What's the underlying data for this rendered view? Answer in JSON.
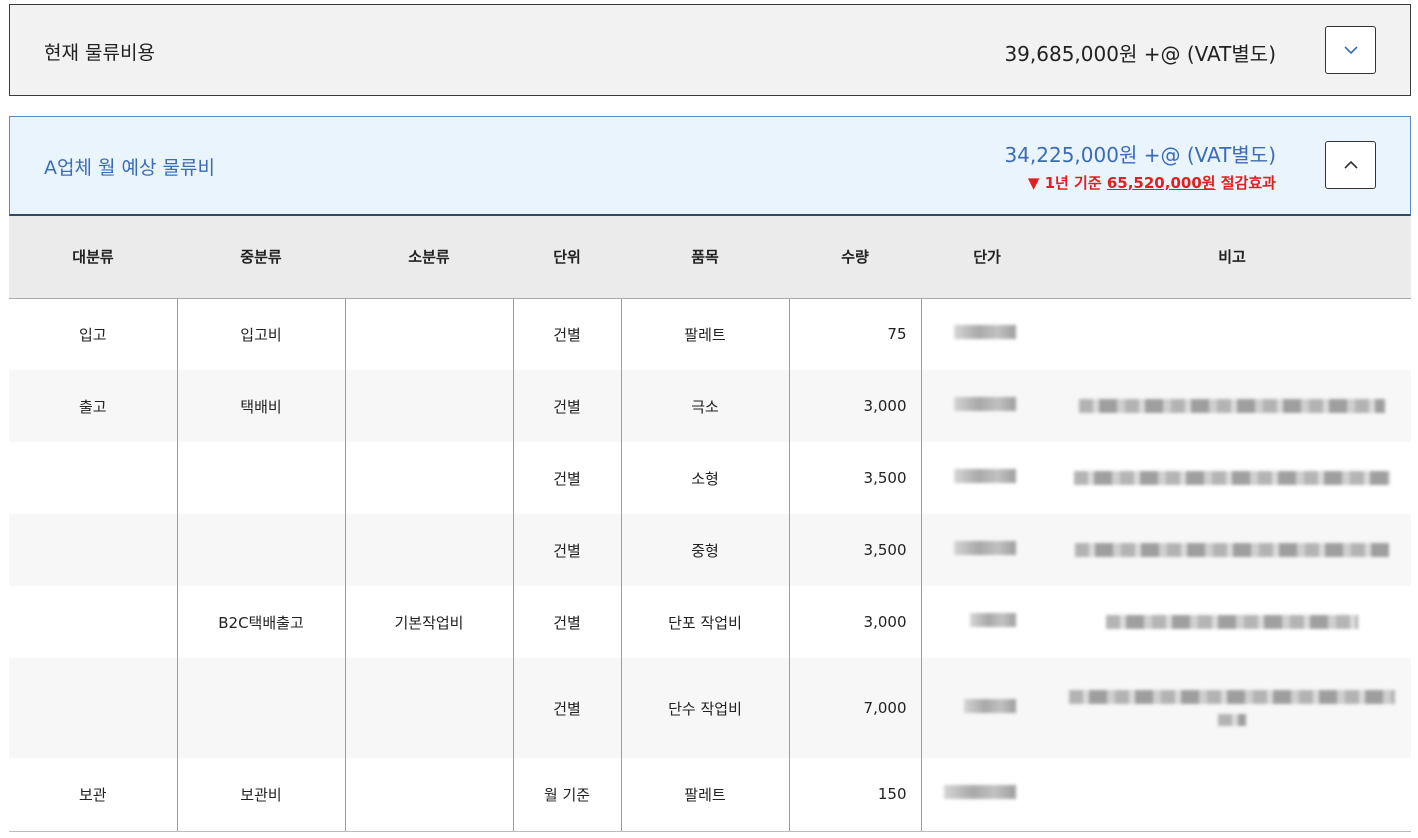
{
  "current_cost": {
    "title": "현재 물류비용",
    "amount": "39,685,000원 +@ (VAT별도)",
    "toggle_icon": "chevron-down-icon"
  },
  "vendor_estimate": {
    "title": "A업체 월 예상 물류비",
    "amount": "34,225,000원 +@ (VAT별도)",
    "savings_prefix": "▼ 1년 기준 ",
    "savings_amount": "65,520,000원",
    "savings_suffix": " 절감효과",
    "toggle_icon": "chevron-up-icon",
    "accent_color": "#3b6cb4",
    "savings_color": "#e02020"
  },
  "table": {
    "headers": [
      "대분류",
      "중분류",
      "소분류",
      "단위",
      "품목",
      "수량",
      "단가",
      "비고"
    ],
    "rows": [
      {
        "major": "입고",
        "middle": "입고비",
        "minor": "",
        "unit": "건별",
        "item": "팔레트",
        "qty": "75"
      },
      {
        "major": "출고",
        "middle": "택배비",
        "minor": "",
        "unit": "건별",
        "item": "극소",
        "qty": "3,000"
      },
      {
        "major": "",
        "middle": "",
        "minor": "",
        "unit": "건별",
        "item": "소형",
        "qty": "3,500"
      },
      {
        "major": "",
        "middle": "",
        "minor": "",
        "unit": "건별",
        "item": "중형",
        "qty": "3,500"
      },
      {
        "major": "",
        "middle": "B2C택배출고",
        "minor": "기본작업비",
        "unit": "건별",
        "item": "단포 작업비",
        "qty": "3,000"
      },
      {
        "major": "",
        "middle": "",
        "minor": "",
        "unit": "건별",
        "item": "단수 작업비",
        "qty": "7,000"
      },
      {
        "major": "보관",
        "middle": "보관비",
        "minor": "",
        "unit": "월 기준",
        "item": "팔레트",
        "qty": "150"
      }
    ]
  }
}
